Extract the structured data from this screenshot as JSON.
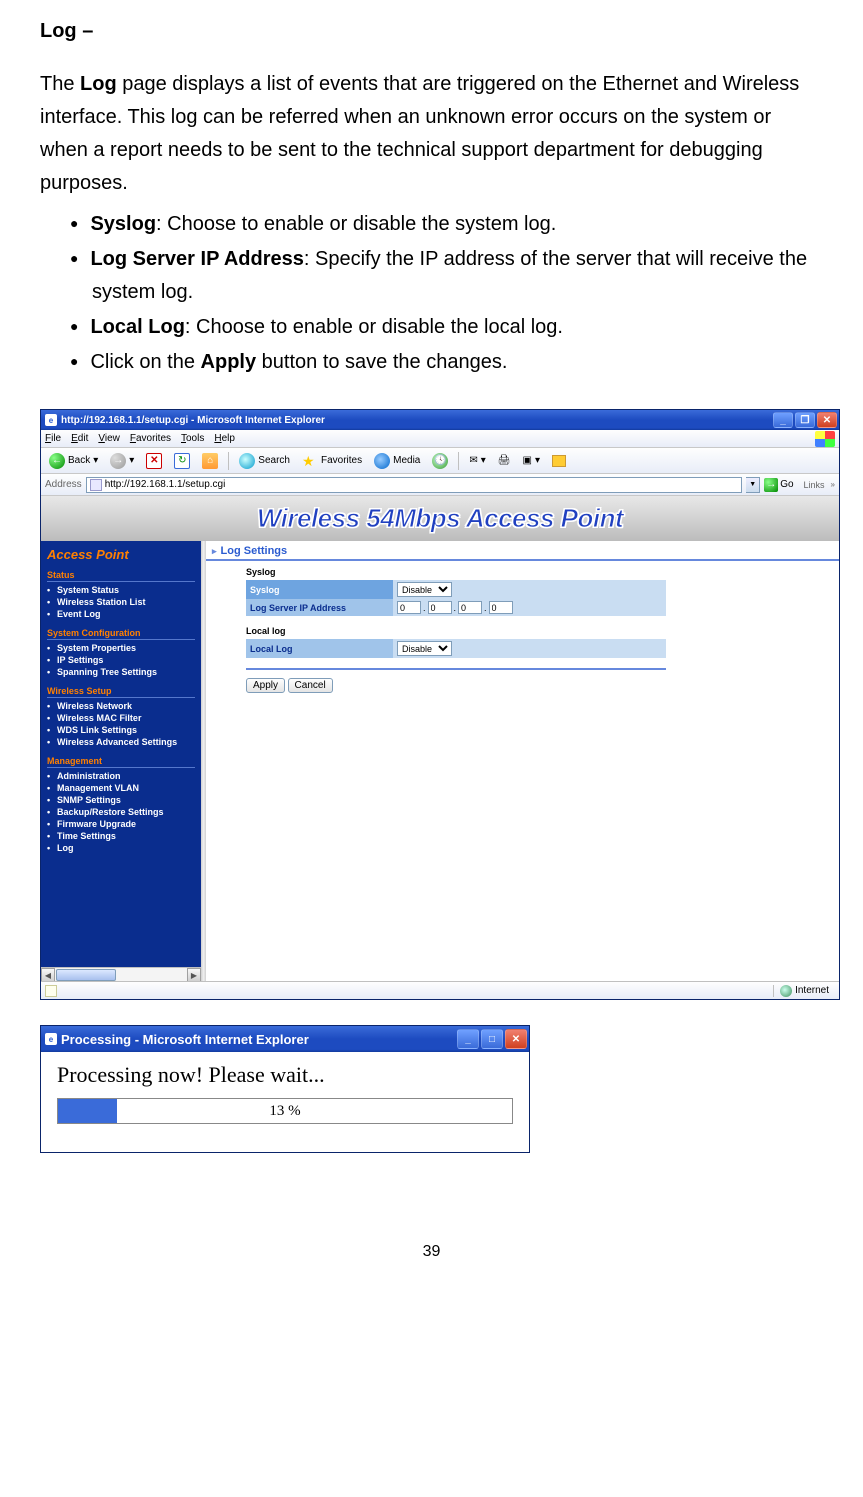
{
  "doc": {
    "heading": "Log –",
    "intro_pre": "The ",
    "intro_bold": "Log",
    "intro_post": " page displays a list of events that are triggered on the Ethernet and Wireless interface. This log can be referred when an unknown error occurs on the system or when a report needs to be sent to the technical support department for debugging purposes.",
    "bullets": [
      {
        "b": "Syslog",
        "t": ": Choose to enable or disable the system log."
      },
      {
        "b": "Log Server IP Address",
        "t": ": Specify the IP address of the server that will receive the system log."
      },
      {
        "b": "Local Log",
        "t": ": Choose to enable or disable the local log."
      },
      {
        "b": "",
        "t": "Click on the ",
        "b2": "Apply",
        "t2": " button to save the changes."
      }
    ],
    "page_number": "39"
  },
  "browser": {
    "title": "http://192.168.1.1/setup.cgi - Microsoft Internet Explorer",
    "menus": [
      "File",
      "Edit",
      "View",
      "Favorites",
      "Tools",
      "Help"
    ],
    "toolbar": {
      "back": "Back",
      "search": "Search",
      "favorites": "Favorites",
      "media": "Media"
    },
    "address_label": "Address",
    "address_value": "http://192.168.1.1/setup.cgi",
    "go": "Go",
    "links": "Links",
    "banner": "Wireless 54Mbps Access Point",
    "sidebar": {
      "title": "Access Point",
      "groups": [
        {
          "head": "Status",
          "items": [
            "System Status",
            "Wireless Station List",
            "Event Log"
          ]
        },
        {
          "head": "System Configuration",
          "items": [
            "System Properties",
            "IP Settings",
            "Spanning Tree Settings"
          ]
        },
        {
          "head": "Wireless Setup",
          "items": [
            "Wireless Network",
            "Wireless MAC Filter",
            "WDS Link Settings",
            "Wireless Advanced Settings"
          ]
        },
        {
          "head": "Management",
          "items": [
            "Administration",
            "Management VLAN",
            "SNMP Settings",
            "Backup/Restore Settings",
            "Firmware Upgrade",
            "Time Settings",
            "Log"
          ]
        }
      ]
    },
    "main": {
      "header": "Log Settings",
      "syslog_sub": "Syslog",
      "syslog_label": "Syslog",
      "syslog_value": "Disable",
      "ip_label": "Log Server IP Address",
      "ip_values": [
        "0",
        "0",
        "0",
        "0"
      ],
      "local_sub": "Local log",
      "local_label": "Local Log",
      "local_value": "Disable",
      "apply": "Apply",
      "cancel": "Cancel"
    },
    "status_internet": "Internet"
  },
  "dialog": {
    "title": "Processing - Microsoft Internet Explorer",
    "message": "Processing now! Please wait...",
    "percent_text": "13 %",
    "percent_value": 13
  }
}
